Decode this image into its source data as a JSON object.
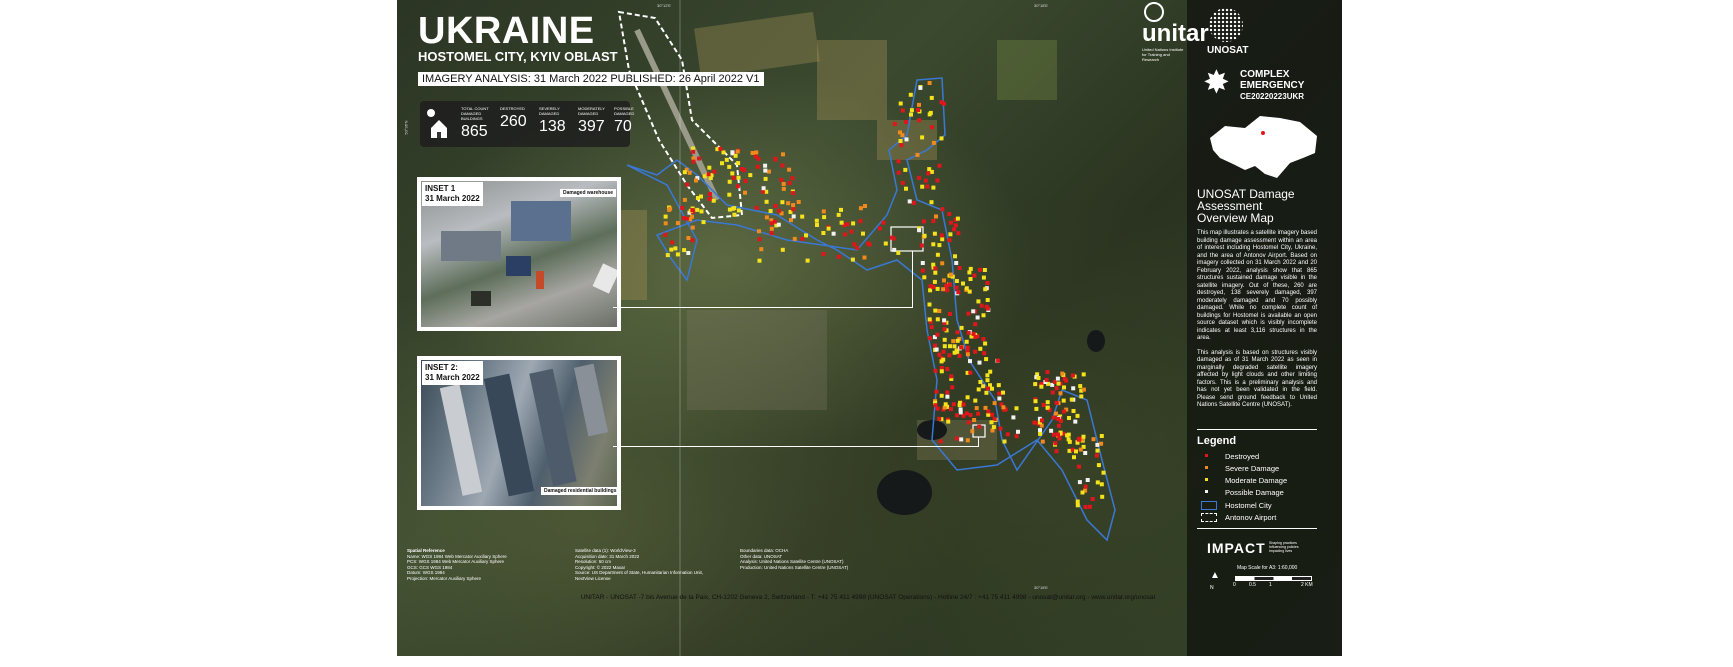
{
  "header": {
    "country": "UKRAINE",
    "location": "HOSTOMEL CITY, KYIV OBLAST",
    "analysis_line": "IMAGERY ANALYSIS: 31 March 2022 PUBLISHED: 26 April 2022 V1"
  },
  "stats": [
    {
      "label": "Total Count Damaged Buildings",
      "value": "865"
    },
    {
      "label": "Destroyed",
      "value": "260"
    },
    {
      "label": "Severely Damaged",
      "value": "138"
    },
    {
      "label": "Moderately Damaged",
      "value": "397"
    },
    {
      "label": "Possible Damaged",
      "value": "70"
    }
  ],
  "insets": [
    {
      "title": "INSET 1",
      "date": "31 March 2022",
      "callout": "Damaged warehouse"
    },
    {
      "title": "INSET 2:",
      "date": "31 March 2022",
      "callout": "Damaged residential buildings"
    }
  ],
  "logos": {
    "unitar": "unitar",
    "unitar_sub": "United Nations Institute for Training and Research",
    "unosat": "UNOSAT"
  },
  "emergency": {
    "line1": "COMPLEX",
    "line2": "EMERGENCY",
    "code": "CE20220223UKR"
  },
  "sidebar": {
    "title": "UNOSAT Damage Assessment Overview Map",
    "paragraph1": "This map illustrates a satellite imagery based building damage assessment within an area of interest including Hostomel City, Ukraine, and the area of Antonov Airport. Based on imagery collected on 31 March 2022 and 20 February 2022, analysis show that 865 structures sustained damage visible in the satellite imagery. Out of these, 260 are destroyed, 138 severely damaged, 397 moderately damaged and 70 possibly damaged. While no complete count of buildings for Hostomel is available an open source dataset which is visibly incomplete indicates at least 3,116 structures in the area.",
    "paragraph2": "This analysis is based on structures visibly damaged as of 31 March 2022 as seen in marginally degraded satellite imagery affected by light clouds and other limiting factors. This is a preliminary analysis and has not yet been validated in the field. Please send ground feedback to United Nations Satellite Centre (UNOSAT)."
  },
  "legend": {
    "title": "Legend",
    "items": [
      {
        "label": "Destroyed",
        "color": "#e0161b"
      },
      {
        "label": "Severe Damage",
        "color": "#f08a1c"
      },
      {
        "label": "Moderate Damage",
        "color": "#f4e31a"
      },
      {
        "label": "Possible Damage",
        "color": "#f2f2f2"
      },
      {
        "label": "Hostomel City",
        "color": "#3a78d6"
      },
      {
        "label": "Antonov Airport",
        "color": "#ffffff"
      }
    ]
  },
  "impact": {
    "name": "IMPACT",
    "tagline": "Shaping practices Influencing policies Impacting lives"
  },
  "scale": {
    "title": "Map Scale for A3: 1:60,000",
    "ticks": [
      "0",
      "0.5",
      "1",
      "2 KM"
    ]
  },
  "meta": {
    "col1": [
      "Spatial Reference",
      "Name: WGS 1984 Web Mercator Auxiliary Sphere",
      "PCS: WGS 1984 Web Mercator Auxiliary Sphere",
      "GCS: GCS WGS 1984",
      "Datum: WGS 1984",
      "Projection: Mercator Auxiliary Sphere"
    ],
    "col2": [
      "Satellite data (1): WorldView-3",
      "Acquisition date: 31 March 2022",
      "Resolution: 50 cm",
      "Copyright: © 2022 Maxar",
      "Source: US Department of State, Humanitarian Information Unit,",
      "NextView License"
    ],
    "col3": [
      "Boundaries data: OCHA",
      "Other data: UNOSAT",
      "Analysis: United Nations Satellite Centre (UNOSAT)",
      "Production: United Nations Satellite Centre (UNOSAT)"
    ]
  },
  "coords": {
    "top1": "30°12'E",
    "top2": "30°18'E",
    "bottom": "30°18'E",
    "left": "50°36'N"
  },
  "footer": "UNITAR - UNOSAT -7 bis Avenue de la Paix, CH-1202 Geneva 2, Switzerland - T: +41 75 411 4998 (UNOSAT Operations) - Hotline 24/7 : +41 75 411 4998 - unosat@unitar.org - www.unitar.org/unosat"
}
